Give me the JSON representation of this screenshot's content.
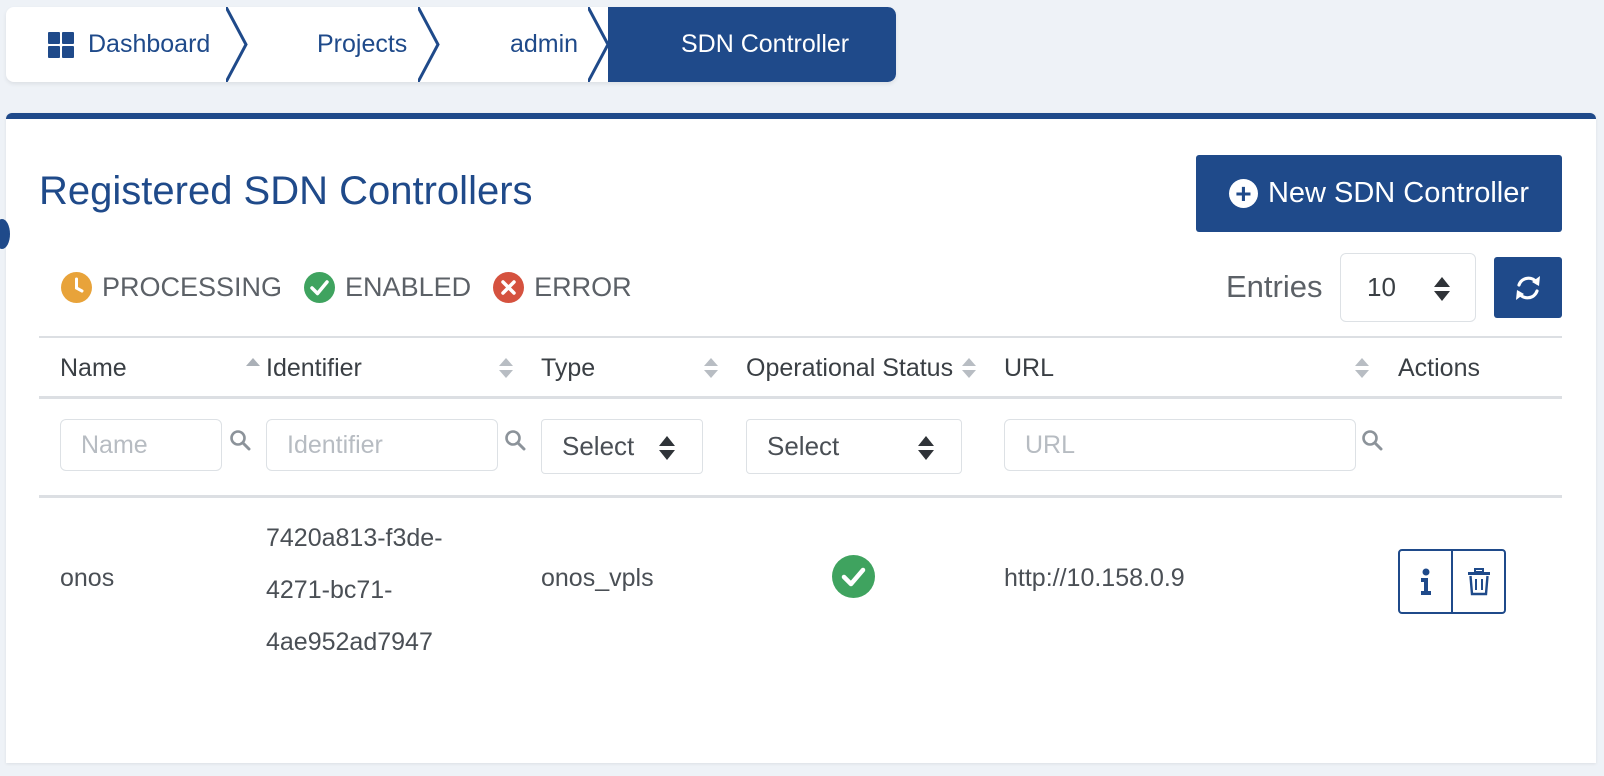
{
  "breadcrumb": {
    "items": [
      {
        "label": "Dashboard",
        "icon": "dashboard-grid-icon"
      },
      {
        "label": "Projects"
      },
      {
        "label": "admin"
      },
      {
        "label": "SDN Controller",
        "active": true
      }
    ]
  },
  "page": {
    "title": "Registered SDN Controllers",
    "new_button_label": "New SDN Controller"
  },
  "legend": [
    {
      "label": "PROCESSING",
      "icon": "clock-icon",
      "color": "#e8a33a"
    },
    {
      "label": "ENABLED",
      "icon": "check-circle-icon",
      "color": "#3fa35f"
    },
    {
      "label": "ERROR",
      "icon": "x-circle-icon",
      "color": "#d5523f"
    }
  ],
  "entries": {
    "label": "Entries",
    "value": "10"
  },
  "table": {
    "columns": [
      "Name",
      "Identifier",
      "Type",
      "Operational Status",
      "URL",
      "Actions"
    ],
    "filters": {
      "name_placeholder": "Name",
      "identifier_placeholder": "Identifier",
      "type_select": "Select",
      "status_select": "Select",
      "url_placeholder": "URL"
    },
    "rows": [
      {
        "name": "onos",
        "identifier_lines": [
          "7420a813-f3de-",
          "4271-bc71-",
          "4ae952ad7947"
        ],
        "type": "onos_vpls",
        "status": "ENABLED",
        "url": "http://10.158.0.9"
      }
    ]
  },
  "colors": {
    "primary": "#1f4a8a",
    "enabled": "#3fa35f",
    "processing": "#e8a33a",
    "error": "#d5523f"
  }
}
